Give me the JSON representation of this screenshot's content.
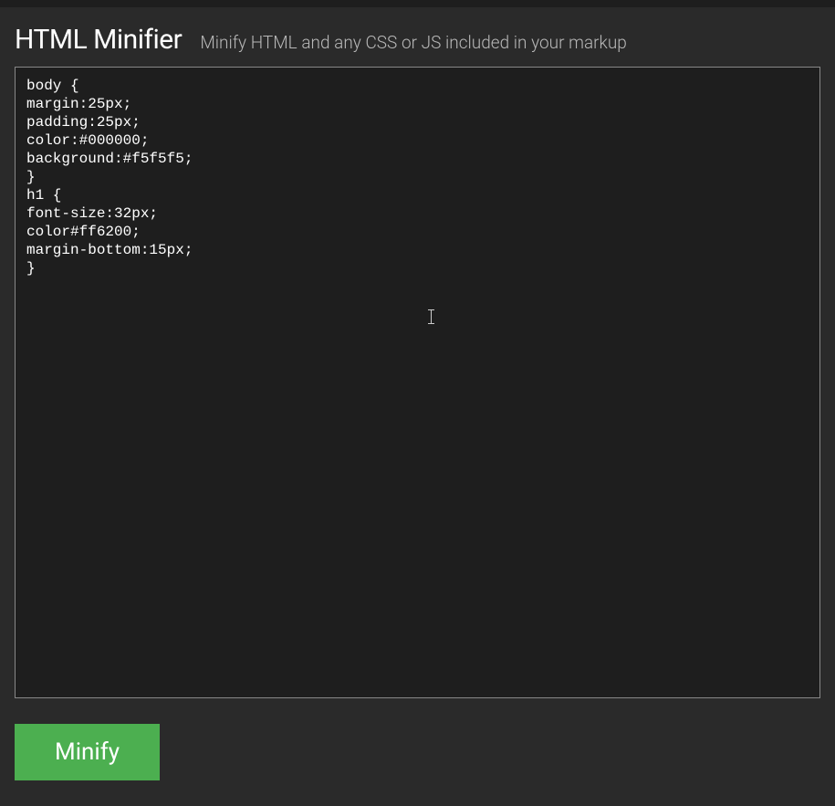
{
  "header": {
    "title": "HTML Minifier",
    "subtitle": "Minify HTML and any CSS or JS included in your markup"
  },
  "editor": {
    "content": "body {\nmargin:25px;\npadding:25px;\ncolor:#000000;\nbackground:#f5f5f5;\n}\nh1 {\nfont-size:32px;\ncolor#ff6200;\nmargin-bottom:15px;\n}"
  },
  "actions": {
    "minify_label": "Minify"
  }
}
